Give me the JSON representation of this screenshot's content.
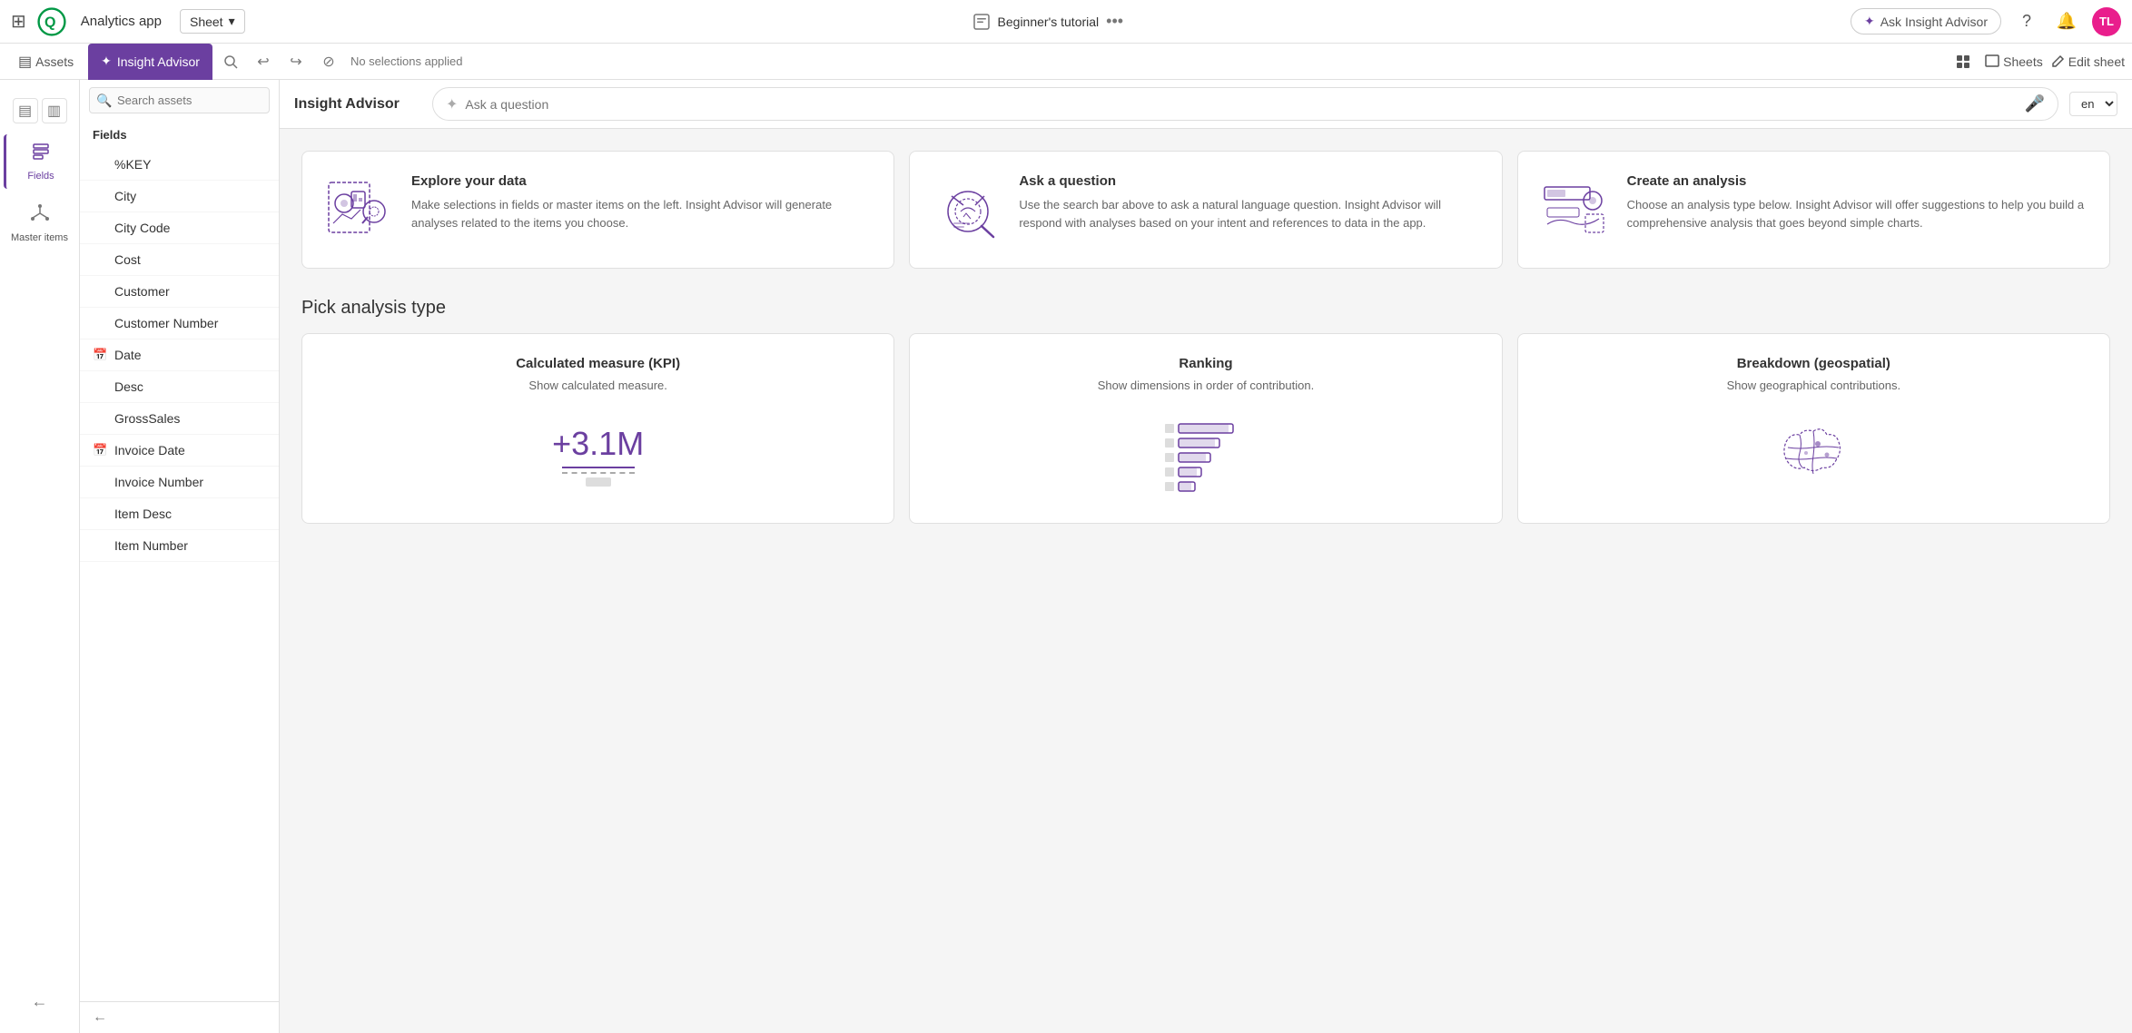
{
  "topNav": {
    "appTitle": "Analytics app",
    "sheetDropdown": "Sheet",
    "tutorialLabel": "Beginner's tutorial",
    "askInsightBtn": "Ask Insight Advisor",
    "avatarInitials": "TL"
  },
  "toolbar": {
    "assetsLabel": "Assets",
    "insightAdvisorLabel": "Insight Advisor",
    "noSelectionsLabel": "No selections applied",
    "sheetsLabel": "Sheets",
    "editSheetLabel": "Edit sheet"
  },
  "sidebar": {
    "fieldsLabel": "Fields",
    "masterItemsLabel": "Master items"
  },
  "fieldsPanel": {
    "title": "Insight Advisor",
    "searchPlaceholder": "Search assets",
    "sectionLabel": "Fields",
    "fields": [
      {
        "name": "%KEY",
        "hasIcon": false
      },
      {
        "name": "City",
        "hasIcon": false
      },
      {
        "name": "City Code",
        "hasIcon": false
      },
      {
        "name": "Cost",
        "hasIcon": false
      },
      {
        "name": "Customer",
        "hasIcon": false
      },
      {
        "name": "Customer Number",
        "hasIcon": false
      },
      {
        "name": "Date",
        "hasIcon": true
      },
      {
        "name": "Desc",
        "hasIcon": false
      },
      {
        "name": "GrossSales",
        "hasIcon": false
      },
      {
        "name": "Invoice Date",
        "hasIcon": true
      },
      {
        "name": "Invoice Number",
        "hasIcon": false
      },
      {
        "name": "Item Desc",
        "hasIcon": false
      },
      {
        "name": "Item Number",
        "hasIcon": false
      }
    ],
    "collapseLabel": ""
  },
  "insightHeader": {
    "title": "Insight Advisor",
    "questionPlaceholder": "Ask a question",
    "langOption": "en"
  },
  "introCards": [
    {
      "id": "explore",
      "title": "Explore your data",
      "description": "Make selections in fields or master items on the left. Insight Advisor will generate analyses related to the items you choose."
    },
    {
      "id": "ask",
      "title": "Ask a question",
      "description": "Use the search bar above to ask a natural language question. Insight Advisor will respond with analyses based on your intent and references to data in the app."
    },
    {
      "id": "create",
      "title": "Create an analysis",
      "description": "Choose an analysis type below. Insight Advisor will offer suggestions to help you build a comprehensive analysis that goes beyond simple charts."
    }
  ],
  "analysisSection": {
    "title": "Pick analysis type",
    "cards": [
      {
        "id": "kpi",
        "title": "Calculated measure (KPI)",
        "description": "Show calculated measure.",
        "vizValue": "+3.1M"
      },
      {
        "id": "ranking",
        "title": "Ranking",
        "description": "Show dimensions in order of contribution."
      },
      {
        "id": "geospatial",
        "title": "Breakdown (geospatial)",
        "description": "Show geographical contributions."
      }
    ]
  }
}
